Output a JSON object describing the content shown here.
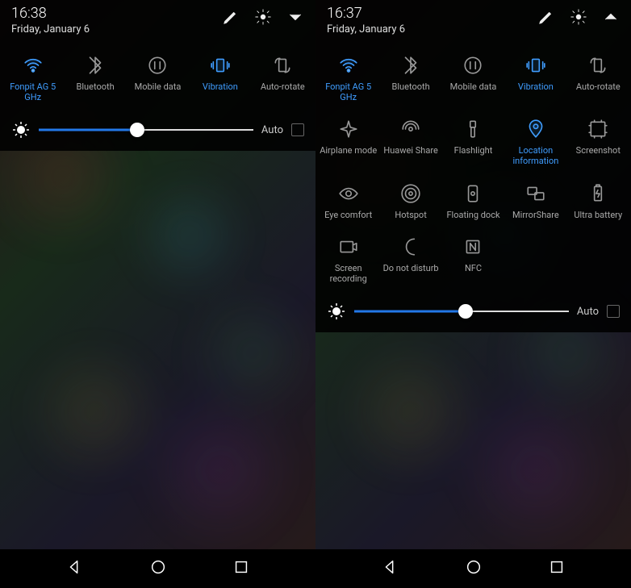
{
  "left": {
    "time": "16:38",
    "date": "Friday, January 6",
    "auto_label": "Auto",
    "brightness_percent": 46,
    "toggles": [
      {
        "id": "wifi",
        "label": "Fonpit AG 5 GHz",
        "active": true
      },
      {
        "id": "bluetooth",
        "label": "Bluetooth",
        "active": false
      },
      {
        "id": "mobiledata",
        "label": "Mobile data",
        "active": false
      },
      {
        "id": "vibration",
        "label": "Vibration",
        "active": true
      },
      {
        "id": "autorotate",
        "label": "Auto-rotate",
        "active": false
      }
    ]
  },
  "right": {
    "time": "16:37",
    "date": "Friday, January 6",
    "auto_label": "Auto",
    "brightness_percent": 52,
    "toggles": [
      {
        "id": "wifi",
        "label": "Fonpit AG 5 GHz",
        "active": true
      },
      {
        "id": "bluetooth",
        "label": "Bluetooth",
        "active": false
      },
      {
        "id": "mobiledata",
        "label": "Mobile data",
        "active": false
      },
      {
        "id": "vibration",
        "label": "Vibration",
        "active": true
      },
      {
        "id": "autorotate",
        "label": "Auto-rotate",
        "active": false
      },
      {
        "id": "airplane",
        "label": "Airplane mode",
        "active": false
      },
      {
        "id": "huaweishare",
        "label": "Huawei Share",
        "active": false
      },
      {
        "id": "flashlight",
        "label": "Flashlight",
        "active": false
      },
      {
        "id": "location",
        "label": "Location information",
        "active": true
      },
      {
        "id": "screenshot",
        "label": "Screenshot",
        "active": false
      },
      {
        "id": "eyecomfort",
        "label": "Eye comfort",
        "active": false
      },
      {
        "id": "hotspot",
        "label": "Hotspot",
        "active": false
      },
      {
        "id": "floatingdock",
        "label": "Floating dock",
        "active": false
      },
      {
        "id": "mirrorshare",
        "label": "MirrorShare",
        "active": false
      },
      {
        "id": "ultrabattery",
        "label": "Ultra battery",
        "active": false
      },
      {
        "id": "screenrecording",
        "label": "Screen recording",
        "active": false
      },
      {
        "id": "dnd",
        "label": "Do not disturb",
        "active": false
      },
      {
        "id": "nfc",
        "label": "NFC",
        "active": false
      }
    ]
  }
}
